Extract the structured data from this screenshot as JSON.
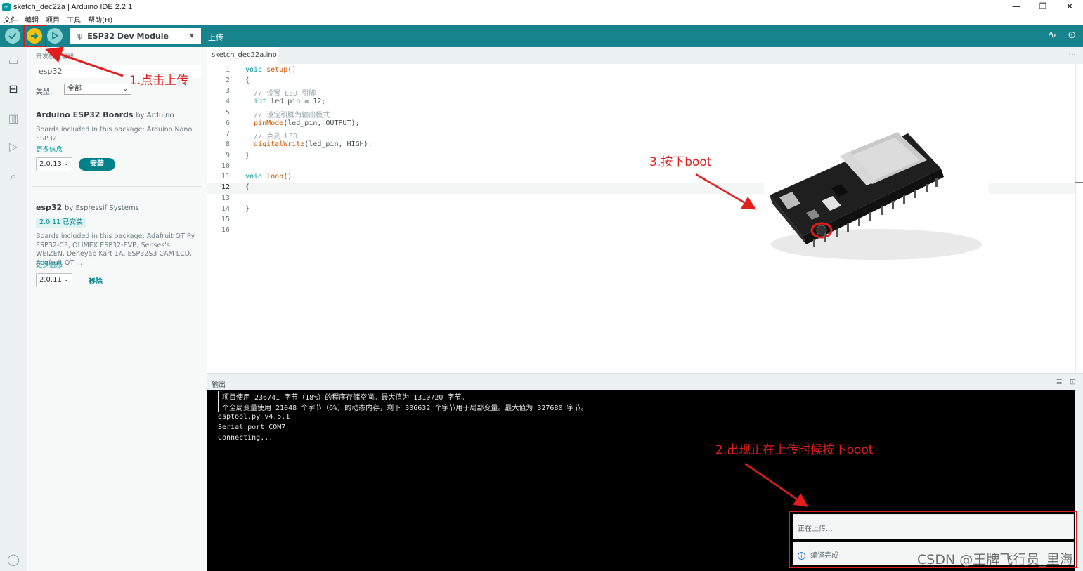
{
  "window": {
    "title": "sketch_dec22a | Arduino IDE 2.2.1",
    "controls": [
      "—",
      "❐",
      "✕"
    ]
  },
  "menu": [
    "文件",
    "编辑",
    "项目",
    "工具",
    "帮助(H)"
  ],
  "toolbar": {
    "board": "ESP32 Dev Module",
    "action_label": "上传"
  },
  "sidebar": {
    "header": "开发板管理器",
    "search_value": "esp32",
    "type_label": "类型:",
    "type_value": "全部",
    "packages": [
      {
        "name": "Arduino ESP32 Boards",
        "by": "by Arduino",
        "desc": "Boards included in this package: Arduino Nano ESP32",
        "more": "更多信息",
        "version": "2.0.13",
        "action": "安装"
      },
      {
        "name": "esp32",
        "by": "by Espressif Systems",
        "installed": "2.0.11 已安装",
        "desc": "Boards included in this package: Adafruit QT Py ESP32-C3, OLIMEX ESP32-EVB, Senses's WEIZEN, Deneyap Kart 1A, ESP32S3 CAM LCD, Adafruit QT ...",
        "more": "更多信息",
        "version": "2.0.11",
        "action": "移除"
      }
    ]
  },
  "editor": {
    "tab": "sketch_dec22a.ino",
    "more": "···",
    "line_numbers": [
      "1",
      "2",
      "3",
      "4",
      "5",
      "6",
      "7",
      "8",
      "9",
      "10",
      "11",
      "12",
      "13",
      "14",
      "15",
      "16"
    ],
    "current_line": 12
  },
  "output": {
    "title": "输出",
    "lines": [
      "项目使用 236741 字节（18%）的程序存储空间。最大值为 1310720 字节。",
      "个全局变量使用 21048 个字节（6%）的动态内存，剩下 306632 个字节用于局部变量。最大值为 327680 字节。",
      "esptool.py v4.5.1",
      "Serial port COM7",
      "Connecting..."
    ]
  },
  "notifications": {
    "uploading": "正在上传...",
    "compiled": "编译完成"
  },
  "annotations": {
    "step1": "1.点击上传",
    "step2": "2.出现正在上传时候按下boot",
    "step3": "3.按下boot"
  },
  "watermark": "CSDN @王牌飞行员_里海",
  "colors": {
    "toolbar": "#17838d",
    "accent": "#00979d",
    "annotation": "#e11d1d"
  }
}
